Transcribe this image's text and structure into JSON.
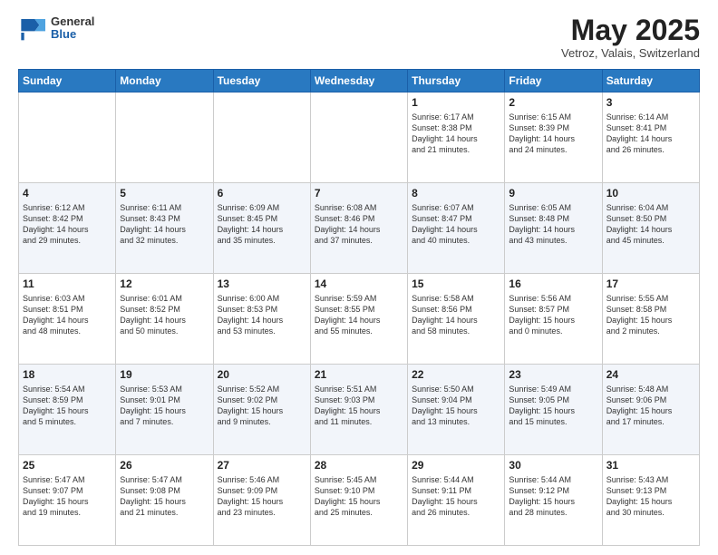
{
  "header": {
    "logo_general": "General",
    "logo_blue": "Blue",
    "month_year": "May 2025",
    "location": "Vetroz, Valais, Switzerland"
  },
  "weekdays": [
    "Sunday",
    "Monday",
    "Tuesday",
    "Wednesday",
    "Thursday",
    "Friday",
    "Saturday"
  ],
  "weeks": [
    [
      {
        "day": "",
        "info": ""
      },
      {
        "day": "",
        "info": ""
      },
      {
        "day": "",
        "info": ""
      },
      {
        "day": "",
        "info": ""
      },
      {
        "day": "1",
        "info": "Sunrise: 6:17 AM\nSunset: 8:38 PM\nDaylight: 14 hours\nand 21 minutes."
      },
      {
        "day": "2",
        "info": "Sunrise: 6:15 AM\nSunset: 8:39 PM\nDaylight: 14 hours\nand 24 minutes."
      },
      {
        "day": "3",
        "info": "Sunrise: 6:14 AM\nSunset: 8:41 PM\nDaylight: 14 hours\nand 26 minutes."
      }
    ],
    [
      {
        "day": "4",
        "info": "Sunrise: 6:12 AM\nSunset: 8:42 PM\nDaylight: 14 hours\nand 29 minutes."
      },
      {
        "day": "5",
        "info": "Sunrise: 6:11 AM\nSunset: 8:43 PM\nDaylight: 14 hours\nand 32 minutes."
      },
      {
        "day": "6",
        "info": "Sunrise: 6:09 AM\nSunset: 8:45 PM\nDaylight: 14 hours\nand 35 minutes."
      },
      {
        "day": "7",
        "info": "Sunrise: 6:08 AM\nSunset: 8:46 PM\nDaylight: 14 hours\nand 37 minutes."
      },
      {
        "day": "8",
        "info": "Sunrise: 6:07 AM\nSunset: 8:47 PM\nDaylight: 14 hours\nand 40 minutes."
      },
      {
        "day": "9",
        "info": "Sunrise: 6:05 AM\nSunset: 8:48 PM\nDaylight: 14 hours\nand 43 minutes."
      },
      {
        "day": "10",
        "info": "Sunrise: 6:04 AM\nSunset: 8:50 PM\nDaylight: 14 hours\nand 45 minutes."
      }
    ],
    [
      {
        "day": "11",
        "info": "Sunrise: 6:03 AM\nSunset: 8:51 PM\nDaylight: 14 hours\nand 48 minutes."
      },
      {
        "day": "12",
        "info": "Sunrise: 6:01 AM\nSunset: 8:52 PM\nDaylight: 14 hours\nand 50 minutes."
      },
      {
        "day": "13",
        "info": "Sunrise: 6:00 AM\nSunset: 8:53 PM\nDaylight: 14 hours\nand 53 minutes."
      },
      {
        "day": "14",
        "info": "Sunrise: 5:59 AM\nSunset: 8:55 PM\nDaylight: 14 hours\nand 55 minutes."
      },
      {
        "day": "15",
        "info": "Sunrise: 5:58 AM\nSunset: 8:56 PM\nDaylight: 14 hours\nand 58 minutes."
      },
      {
        "day": "16",
        "info": "Sunrise: 5:56 AM\nSunset: 8:57 PM\nDaylight: 15 hours\nand 0 minutes."
      },
      {
        "day": "17",
        "info": "Sunrise: 5:55 AM\nSunset: 8:58 PM\nDaylight: 15 hours\nand 2 minutes."
      }
    ],
    [
      {
        "day": "18",
        "info": "Sunrise: 5:54 AM\nSunset: 8:59 PM\nDaylight: 15 hours\nand 5 minutes."
      },
      {
        "day": "19",
        "info": "Sunrise: 5:53 AM\nSunset: 9:01 PM\nDaylight: 15 hours\nand 7 minutes."
      },
      {
        "day": "20",
        "info": "Sunrise: 5:52 AM\nSunset: 9:02 PM\nDaylight: 15 hours\nand 9 minutes."
      },
      {
        "day": "21",
        "info": "Sunrise: 5:51 AM\nSunset: 9:03 PM\nDaylight: 15 hours\nand 11 minutes."
      },
      {
        "day": "22",
        "info": "Sunrise: 5:50 AM\nSunset: 9:04 PM\nDaylight: 15 hours\nand 13 minutes."
      },
      {
        "day": "23",
        "info": "Sunrise: 5:49 AM\nSunset: 9:05 PM\nDaylight: 15 hours\nand 15 minutes."
      },
      {
        "day": "24",
        "info": "Sunrise: 5:48 AM\nSunset: 9:06 PM\nDaylight: 15 hours\nand 17 minutes."
      }
    ],
    [
      {
        "day": "25",
        "info": "Sunrise: 5:47 AM\nSunset: 9:07 PM\nDaylight: 15 hours\nand 19 minutes."
      },
      {
        "day": "26",
        "info": "Sunrise: 5:47 AM\nSunset: 9:08 PM\nDaylight: 15 hours\nand 21 minutes."
      },
      {
        "day": "27",
        "info": "Sunrise: 5:46 AM\nSunset: 9:09 PM\nDaylight: 15 hours\nand 23 minutes."
      },
      {
        "day": "28",
        "info": "Sunrise: 5:45 AM\nSunset: 9:10 PM\nDaylight: 15 hours\nand 25 minutes."
      },
      {
        "day": "29",
        "info": "Sunrise: 5:44 AM\nSunset: 9:11 PM\nDaylight: 15 hours\nand 26 minutes."
      },
      {
        "day": "30",
        "info": "Sunrise: 5:44 AM\nSunset: 9:12 PM\nDaylight: 15 hours\nand 28 minutes."
      },
      {
        "day": "31",
        "info": "Sunrise: 5:43 AM\nSunset: 9:13 PM\nDaylight: 15 hours\nand 30 minutes."
      }
    ]
  ]
}
